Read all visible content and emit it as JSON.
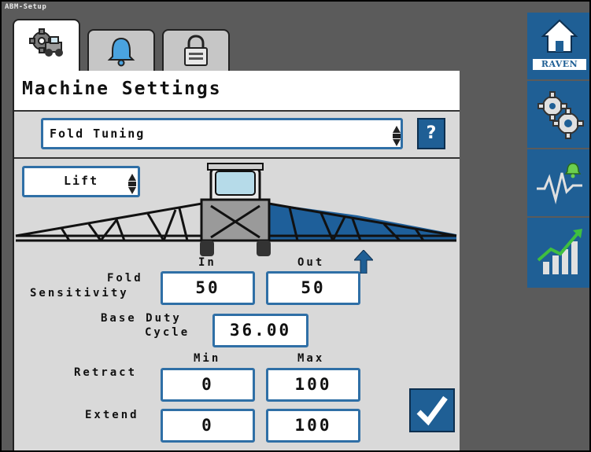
{
  "window": {
    "title": "ABM-Setup"
  },
  "tabs": [
    {
      "name": "machine-settings",
      "icon": "machine-gear-icon"
    },
    {
      "name": "alarms",
      "icon": "bell-icon"
    },
    {
      "name": "lock",
      "icon": "padlock-icon"
    }
  ],
  "panel": {
    "title": "Machine Settings"
  },
  "fold_select": {
    "value": "Fold Tuning"
  },
  "help": {
    "label": "?"
  },
  "lift_select": {
    "value": "Lift"
  },
  "columns": {
    "in": "In",
    "out": "Out",
    "min": "Min",
    "max": "Max"
  },
  "fold_sensitivity": {
    "label_line1": "Fold",
    "label_line2": "Sensitivity",
    "in": "50",
    "out": "50"
  },
  "base_duty": {
    "label_line1": "Base Duty",
    "label_line2": "Cycle",
    "value": "36.00"
  },
  "retract": {
    "label": "Retract",
    "min": "0",
    "max": "100"
  },
  "extend": {
    "label": "Extend",
    "min": "0",
    "max": "100"
  },
  "sidebar": {
    "home": {
      "icon": "home-icon",
      "brand": "RAVEN"
    },
    "settings": {
      "icon": "gears-icon"
    },
    "diagnostics": {
      "icon": "diagnostics-alert-icon"
    },
    "performance": {
      "icon": "performance-chart-icon"
    }
  },
  "colors": {
    "accent": "#1f5f95",
    "field_border": "#2f6fa6",
    "boom_active": "#1e5f9a",
    "background": "#5b5b5b"
  }
}
